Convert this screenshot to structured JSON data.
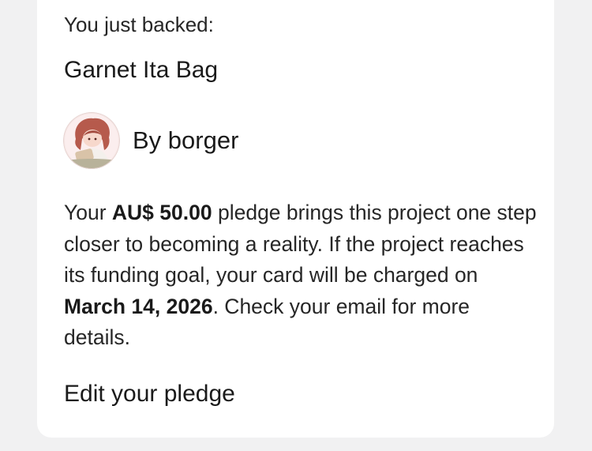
{
  "backed": {
    "intro_label": "You just backed:",
    "project_title": "Garnet Ita Bag"
  },
  "creator": {
    "label": "By borger",
    "avatar_icon": "creator-avatar"
  },
  "pledge": {
    "part1": "Your ",
    "amount": "AU$ 50.00",
    "part2": " pledge brings this project one step closer to becoming a reality. If the project reaches its funding goal, your card will be charged on ",
    "charge_date": "March 14, 2026",
    "part3": ". Check your email for more details."
  },
  "actions": {
    "edit_pledge_label": "Edit your pledge"
  }
}
